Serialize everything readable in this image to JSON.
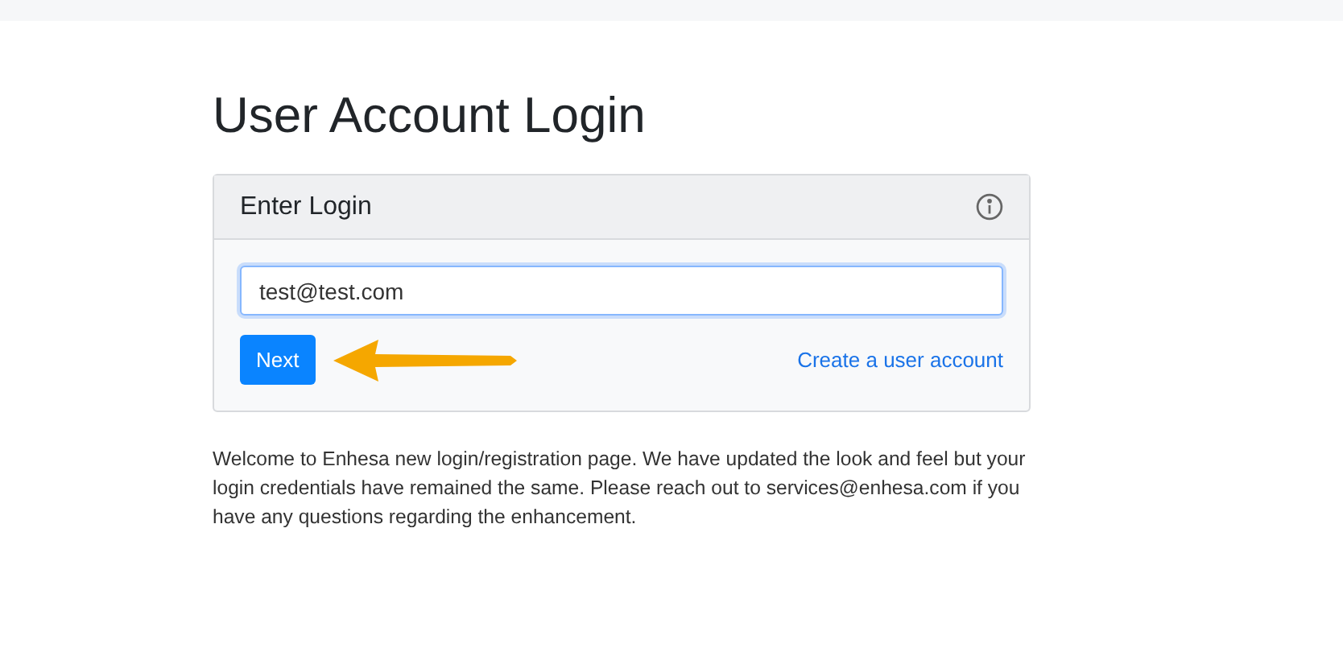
{
  "page": {
    "title": "User Account Login"
  },
  "card": {
    "header": "Enter Login",
    "email_field": {
      "value": "test@test.com",
      "focused": true
    },
    "next_button": "Next",
    "create_account_link": "Create a user account"
  },
  "notice": "Welcome to Enhesa new login/registration page. We have updated the look and feel but your login credentials have remained the same. Please reach out to services@enhesa.com if you have any questions regarding the enhancement."
}
